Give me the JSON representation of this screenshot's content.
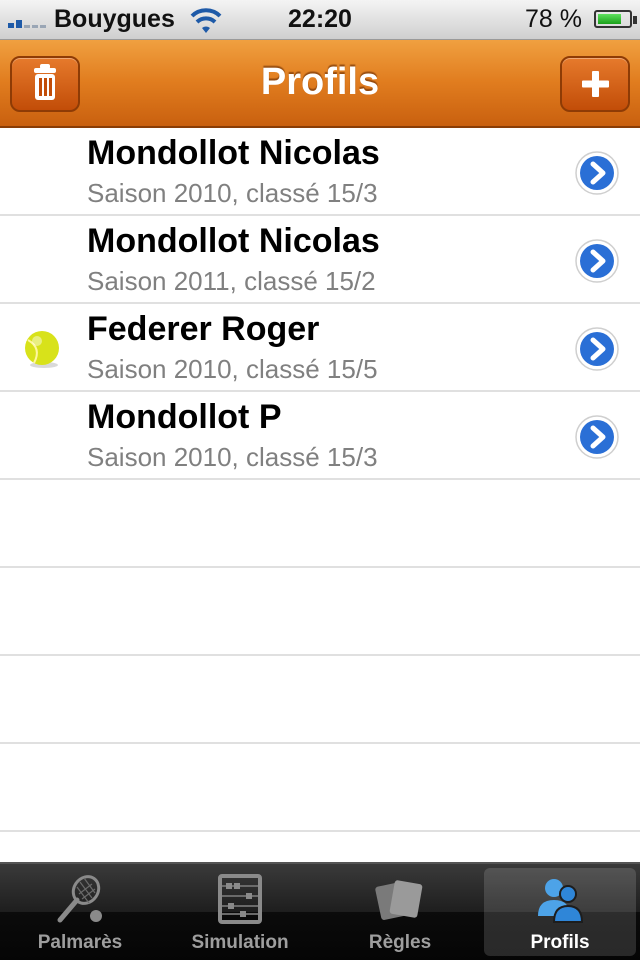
{
  "status_bar": {
    "carrier": "Bouygues",
    "time": "22:20",
    "battery_percent": "78 %",
    "battery_level": 0.78
  },
  "nav": {
    "title": "Profils",
    "delete_icon": "trash-icon",
    "add_icon": "plus-icon"
  },
  "profiles": [
    {
      "name": "Mondollot Nicolas",
      "detail": "Saison 2010, classé 15/3",
      "selected": false
    },
    {
      "name": "Mondollot Nicolas",
      "detail": "Saison 2011, classé 15/2",
      "selected": false
    },
    {
      "name": "Federer Roger",
      "detail": "Saison 2010, classé 15/5",
      "selected": true
    },
    {
      "name": "Mondollot P",
      "detail": "Saison 2010, classé 15/3",
      "selected": false
    }
  ],
  "tabs": [
    {
      "label": "Palmarès",
      "icon": "tennis-racket-icon",
      "active": false
    },
    {
      "label": "Simulation",
      "icon": "abacus-icon",
      "active": false
    },
    {
      "label": "Règles",
      "icon": "cards-icon",
      "active": false
    },
    {
      "label": "Profils",
      "icon": "users-icon",
      "active": true
    }
  ],
  "colors": {
    "nav_orange": "#e17d1f",
    "disclosure_blue": "#2a6fd6",
    "ball_yellow": "#d8e21a"
  }
}
